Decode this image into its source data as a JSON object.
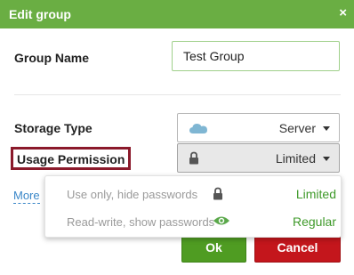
{
  "dialog": {
    "title": "Edit group",
    "close_glyph": "×"
  },
  "form": {
    "group_name_label": "Group Name",
    "group_name_value": "Test Group",
    "storage_type_label": "Storage Type",
    "storage_type_value": "Server",
    "storage_type_icon": "cloud-icon",
    "usage_permission_label": "Usage Permission",
    "usage_permission_value": "Limited",
    "usage_permission_icon": "lock-icon",
    "more_link": "More"
  },
  "dropdown": {
    "options": [
      {
        "description": "Use only, hide passwords",
        "icon": "lock-icon",
        "value": "Limited"
      },
      {
        "description": "Read-write, show passwords",
        "icon": "eye-icon",
        "value": "Regular"
      }
    ]
  },
  "buttons": {
    "ok_label": "Ok",
    "cancel_label": "Cancel"
  },
  "colors": {
    "titlebar": "#6aae43",
    "ok_button": "#4f9c22",
    "cancel_button": "#c4161c",
    "highlight_border": "#8b1a2b",
    "option_value": "#3f9a2a",
    "link": "#3a87c8"
  }
}
